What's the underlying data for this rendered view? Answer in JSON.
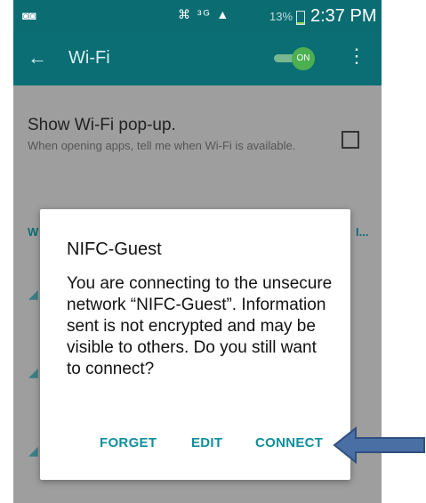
{
  "status_bar": {
    "icons": "⌘ ³ᴳ ▲",
    "battery": "13%",
    "battery_level": 0.13,
    "time": "2:37 PM"
  },
  "app_bar": {
    "title": "Wi-Fi",
    "toggle_label": "ON"
  },
  "setting": {
    "title": "Show Wi-Fi pop-up.",
    "description": "When opening apps, tell me when Wi-Fi is available."
  },
  "section": {
    "partial_letter": "W",
    "more": "I..."
  },
  "dialog": {
    "title": "NIFC-Guest",
    "body": "You are connecting to the unsecure network “NIFC-Guest”. Information sent is not encrypted and may be visible to others. Do you still want to connect?",
    "buttons": {
      "forget": "FORGET",
      "edit": "EDIT",
      "connect": "CONNECT"
    }
  },
  "colors": {
    "status_bar": "#0b6d72",
    "app_bar": "#0a6e74",
    "accent": "#0f8f9c",
    "toggle_on": "#4caf50",
    "arrow": "#4a6fa5"
  }
}
